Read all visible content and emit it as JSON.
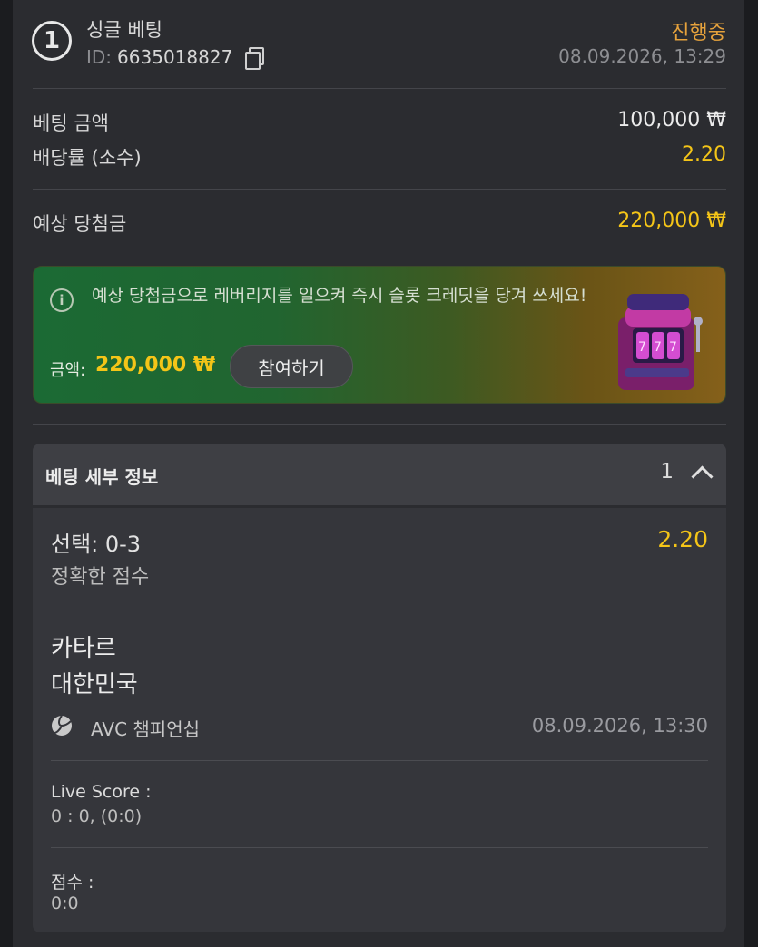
{
  "header": {
    "bet_number": "1",
    "title": "싱글 베팅",
    "id_label": "ID:",
    "id_value": "6635018827",
    "status": "진행중",
    "datetime": "08.09.2026, 13:29"
  },
  "summary": {
    "stake_label": "베팅 금액",
    "stake_value": "100,000 ₩",
    "odds_label": "배당률 (소수)",
    "odds_value": "2.20",
    "payout_label": "예상 당첨금",
    "payout_value": "220,000 ₩"
  },
  "promo": {
    "text": "예상 당첨금으로 레버리지를 일으켜 즉시 슬롯 크레딧을 당겨 쓰세요!",
    "amount_label": "금액:",
    "amount_value": "220,000 ₩",
    "button_label": "참여하기"
  },
  "details": {
    "title": "베팅 세부 정보",
    "count": "1",
    "selection": "선택: 0-3",
    "selection_odds": "2.20",
    "market": "정확한 점수",
    "team_home": "카타르",
    "team_away": "대한민국",
    "league": "AVC 챔피언십",
    "match_time": "08.09.2026, 13:30",
    "live_score_label": "Live Score :",
    "live_score_value": "0 : 0, (0:0)",
    "score_label": "점수 :",
    "score_value": "0:0"
  },
  "colors": {
    "accent_yellow": "#f4c518",
    "status_orange": "#e6a23c",
    "panel_bg": "#2b2c30"
  },
  "icons": [
    "number-badge-icon",
    "copy-icon",
    "info-icon",
    "slot-machine-icon",
    "chevron-up-icon",
    "volleyball-icon"
  ]
}
